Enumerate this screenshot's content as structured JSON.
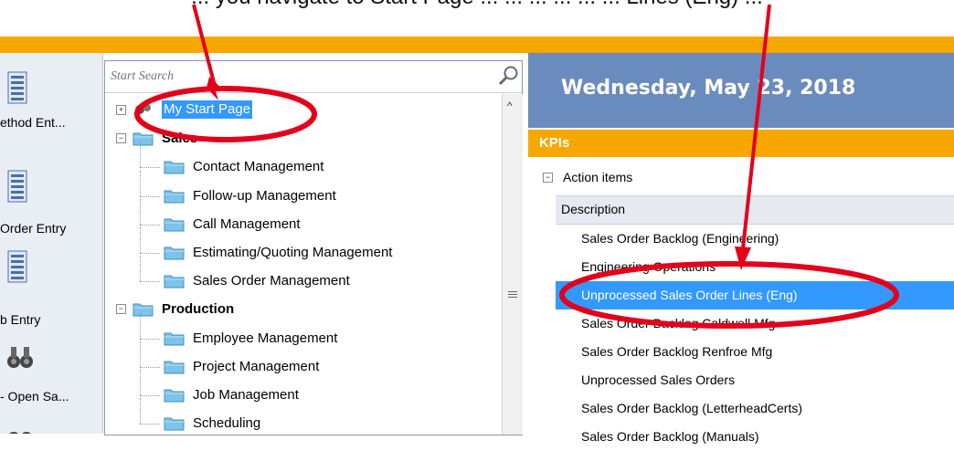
{
  "caption": {
    "text": "... you navigate to Start Page ... ... ... ... ... ... Lines (Eng) ..."
  },
  "left_strip": {
    "items": [
      {
        "label": "ethod Ent...",
        "icon": "form-icon"
      },
      {
        "label": "Order Entry",
        "icon": "form-icon"
      },
      {
        "label": "b Entry",
        "icon": "form-icon"
      },
      {
        "label": "- Open Sa...",
        "icon": "binoculars-icon"
      }
    ]
  },
  "tree": {
    "search_placeholder": "Start Search",
    "items": [
      {
        "label": "My Start Page",
        "level": 0,
        "selected": true,
        "expander": "+"
      },
      {
        "label": "Sales",
        "level": 0,
        "bold": true,
        "expander": "−"
      },
      {
        "label": "Contact Management",
        "level": 1
      },
      {
        "label": "Follow-up Management",
        "level": 1
      },
      {
        "label": "Call Management",
        "level": 1
      },
      {
        "label": "Estimating/Quoting Management",
        "level": 1
      },
      {
        "label": "Sales Order Management",
        "level": 1
      },
      {
        "label": "Production",
        "level": 0,
        "bold": true,
        "expander": "−"
      },
      {
        "label": "Employee Management",
        "level": 1
      },
      {
        "label": "Project Management",
        "level": 1
      },
      {
        "label": "Job Management",
        "level": 1
      },
      {
        "label": "Scheduling",
        "level": 1
      }
    ]
  },
  "kpi": {
    "date": "Wednesday, May 23, 2018",
    "section_title": "KPIs",
    "action_items": "Action items",
    "column_header": "Description",
    "items": [
      {
        "label": "Sales Order Backlog (Engineering)"
      },
      {
        "label": "Engineering Operations"
      },
      {
        "label": "Unprocessed Sales Order Lines (Eng)",
        "selected": true
      },
      {
        "label": "Sales Order Backlog Caldwell Mfg"
      },
      {
        "label": "Sales Order Backlog Renfroe Mfg"
      },
      {
        "label": "Unprocessed Sales Orders"
      },
      {
        "label": "Sales Order Backlog (LetterheadCerts)"
      },
      {
        "label": "Sales Order Backlog (Manuals)"
      }
    ]
  },
  "colors": {
    "accent": "#f7a800",
    "header_blue": "#6a8bbd",
    "selection": "#3399ff",
    "annotation": "#e3001b"
  }
}
